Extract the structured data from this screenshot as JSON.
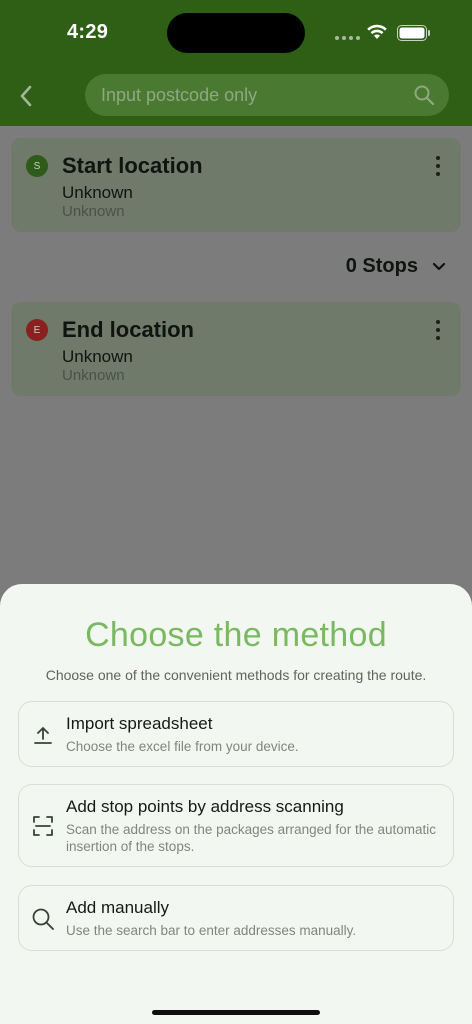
{
  "status": {
    "time": "4:29"
  },
  "header": {
    "search_placeholder": "Input postcode only"
  },
  "start": {
    "badge": "S",
    "title": "Start location",
    "name": "Unknown",
    "sub": "Unknown"
  },
  "stops": {
    "label": "0 Stops"
  },
  "end": {
    "badge": "E",
    "title": "End location",
    "name": "Unknown",
    "sub": "Unknown"
  },
  "sheet": {
    "title": "Choose the method",
    "subtitle": "Choose one of the convenient methods for creating the route.",
    "options": [
      {
        "title": "Import spreadsheet",
        "desc": "Choose the excel file from your device.",
        "icon": "upload-icon"
      },
      {
        "title": "Add stop points by address scanning",
        "desc": "Scan the address on the packages arranged for the automatic insertion of the stops.",
        "icon": "scan-icon"
      },
      {
        "title": "Add manually",
        "desc": "Use the search bar to enter addresses manually.",
        "icon": "search-icon"
      }
    ]
  },
  "colors": {
    "header_green": "#2f5f15",
    "accent_green": "#7ab861",
    "start_badge": "#2e5b19",
    "end_badge": "#8a2020",
    "sheet_bg": "#f3f7f1"
  }
}
